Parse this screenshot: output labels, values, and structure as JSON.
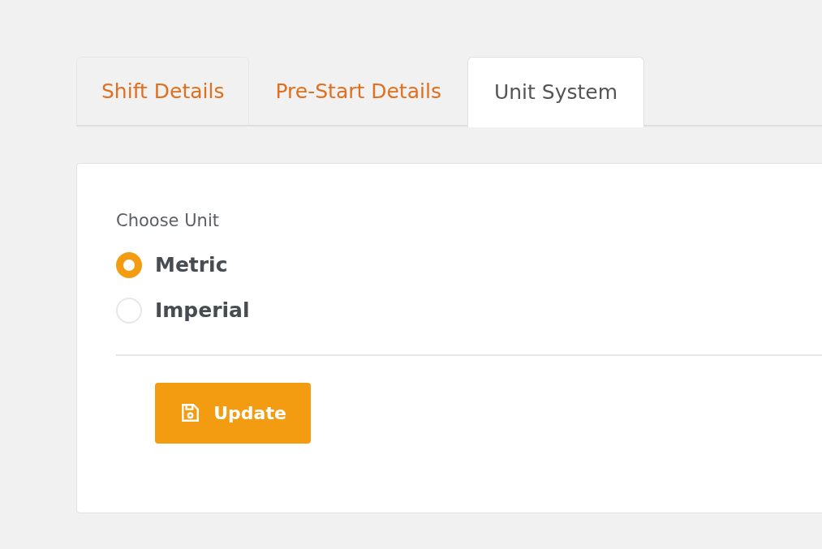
{
  "tabs": [
    {
      "label": "Shift Details",
      "selected": false
    },
    {
      "label": "Pre-Start Details",
      "selected": false
    },
    {
      "label": "Unit System",
      "selected": true
    }
  ],
  "form": {
    "label": "Choose Unit",
    "options": [
      {
        "label": "Metric",
        "selected": true
      },
      {
        "label": "Imperial",
        "selected": false
      }
    ],
    "button": "Update"
  }
}
